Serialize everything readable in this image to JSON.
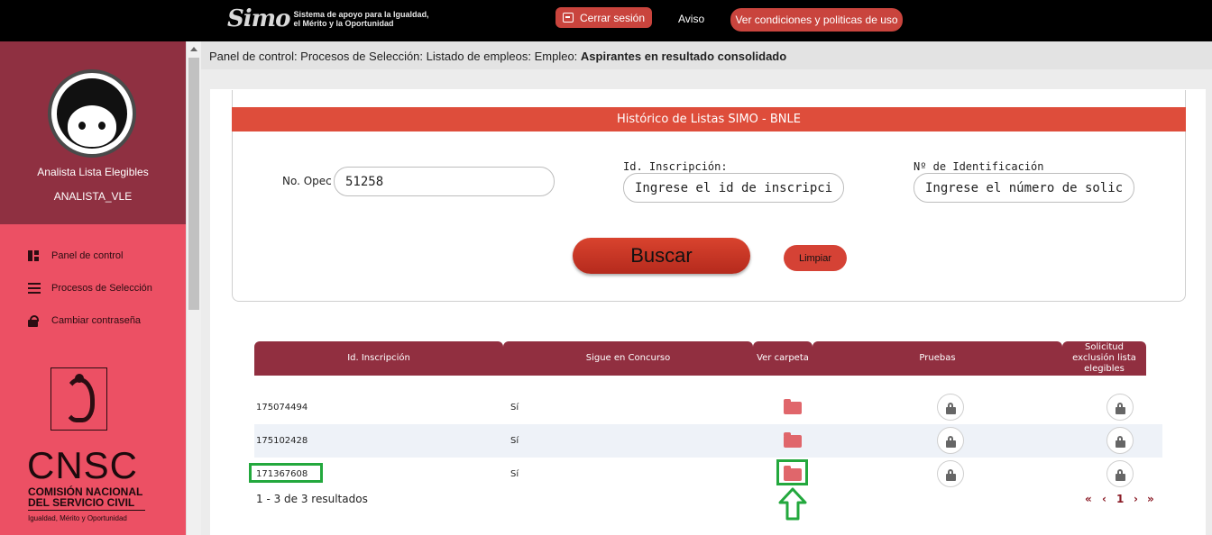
{
  "topbar": {
    "logo_mark": "Simo",
    "logo_line1": "Sistema de apoyo para la Igualdad,",
    "logo_line2": "el Mérito y la Oportunidad",
    "logout_label": "Cerrar sesión",
    "aviso_label": "Aviso",
    "conditions_label": "Ver condiciones y politicas de uso"
  },
  "sidebar": {
    "role": "Analista Lista Elegibles",
    "username": "ANALISTA_VLE",
    "items": [
      {
        "label": "Panel de control",
        "icon": "dashboard-icon"
      },
      {
        "label": "Procesos de Selección",
        "icon": "list-icon"
      },
      {
        "label": "Cambiar contraseña",
        "icon": "lock-icon"
      }
    ],
    "org_title": "CNSC",
    "org_line1": "COMISIÓN NACIONAL",
    "org_line2": "DEL SERVICIO CIVIL",
    "org_motto": "Igualdad, Mérito y Oportunidad"
  },
  "breadcrumb": {
    "path": "Panel de control: Procesos de Selección: Listado de empleos: Empleo: ",
    "current": "Aspirantes en resultado consolidado"
  },
  "filter": {
    "header": "Histórico de Listas SIMO - BNLE",
    "opec_label": "No. Opec",
    "opec_value": "51258",
    "inscription_label": "Id. Inscripción:",
    "inscription_placeholder": "Ingrese el id de inscripción",
    "identification_label": "Nº de Identificación",
    "identification_placeholder": "Ingrese el número de solicitud",
    "search_label": "Buscar",
    "clear_label": "Limpiar"
  },
  "table": {
    "headers": [
      "Id. Inscripción",
      "Sigue en Concurso",
      "Ver carpeta",
      "Pruebas",
      "Solicitud exclusión lista elegibles"
    ],
    "rows": [
      {
        "id": "175074494",
        "status": "Sí"
      },
      {
        "id": "175102428",
        "status": "Sí"
      },
      {
        "id": "171367608",
        "status": "Sí"
      }
    ],
    "result_count": "1 - 3 de 3 resultados",
    "pager": {
      "first": "«",
      "prev": "‹",
      "page": "1",
      "next": "›",
      "last": "»"
    }
  },
  "colors": {
    "accent_red": "#de4d3b",
    "header_maroon": "#912f40",
    "sidebar_pink": "#ec5064",
    "highlight_green": "#23a83d"
  }
}
